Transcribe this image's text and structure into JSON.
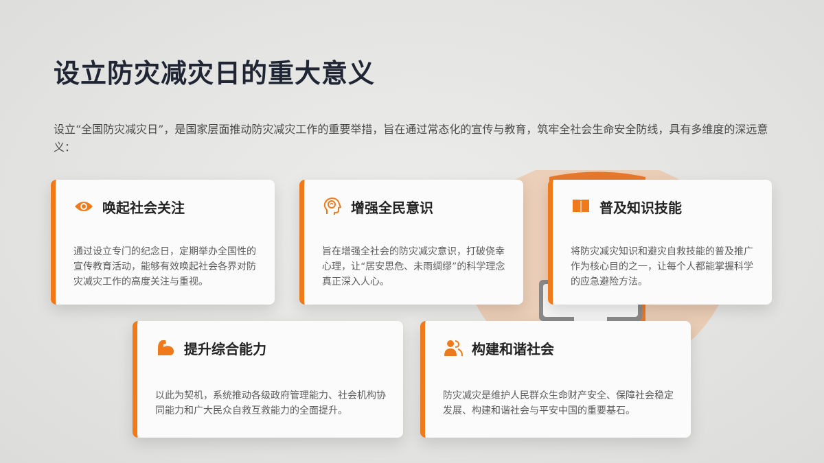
{
  "page": {
    "title": "设立防灾减灾日的重大意义",
    "intro": "设立“全国防灾减灾日”，是国家层面推动防灾减灾工作的重要举措，旨在通过常态化的宣传与教育，筑牢全社会生命安全防线，具有多维度的深远意义："
  },
  "accent_color": "#f07a1a",
  "cards": [
    {
      "icon": "eye-icon",
      "title": "唤起社会关注",
      "body": "通过设立专门的纪念日，定期举办全国性的宣传教育活动，能够有效唤起社会各界对防灾减灾工作的高度关注与重视。"
    },
    {
      "icon": "brain-head-icon",
      "title": "增强全民意识",
      "body": "旨在增强全社会的防灾减灾意识，打破侥幸心理，让“居安思危、未雨绸缪”的科学理念真正深入人心。"
    },
    {
      "icon": "book-icon",
      "title": "普及知识技能",
      "body": "将防灾减灾知识和避灾自救技能的普及推广作为核心目的之一，让每个人都能掌握科学的应急避险方法。"
    },
    {
      "icon": "muscle-arm-icon",
      "title": "提升综合能力",
      "body": "以此为契机，系统推动各级政府管理能力、社会机构协同能力和广大民众自救互救能力的全面提升。"
    },
    {
      "icon": "people-icon",
      "title": "构建和谐社会",
      "body": "防灾减灾是维护人民群众生命财产安全、保障社会稳定发展、构建和谐社会与平安中国的重要基石。"
    }
  ]
}
